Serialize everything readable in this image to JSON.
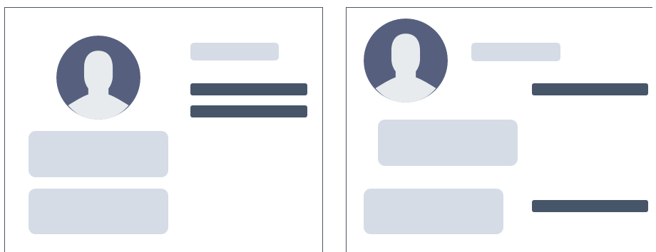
{
  "colors": {
    "frame": "#4a5568",
    "avatar_bg": "#56607e",
    "avatar_silhouette": "#e7ebee",
    "placeholder_light": "#d5dce6",
    "placeholder_dark": "#475569"
  },
  "panels": [
    {
      "icon": "user-avatar-icon",
      "elements": [
        "avatar",
        "title-placeholder",
        "text-line",
        "text-line",
        "block",
        "block"
      ]
    },
    {
      "icon": "user-avatar-icon",
      "elements": [
        "avatar",
        "title-placeholder",
        "text-line",
        "block",
        "block",
        "text-line"
      ]
    }
  ]
}
